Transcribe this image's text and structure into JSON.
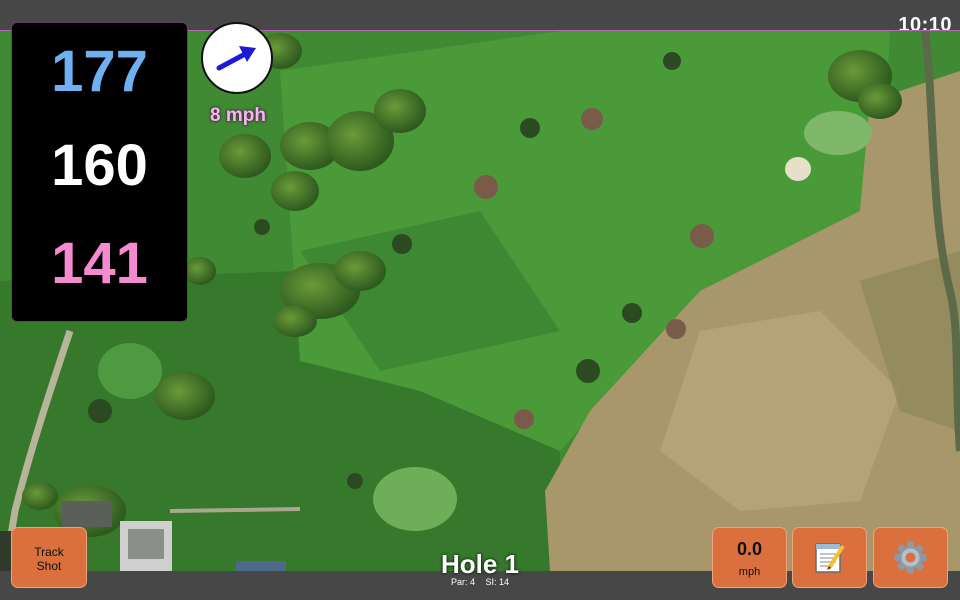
{
  "status_bar": {
    "time": "10:10"
  },
  "distances": {
    "back": "177",
    "middle": "160",
    "front": "141"
  },
  "wind": {
    "speed": "8 mph",
    "icon": "arrow-icon",
    "direction": "north-east"
  },
  "hole": {
    "title": "Hole 1",
    "par": "Par: 4",
    "stroke_index": "SI: 14"
  },
  "buttons": {
    "track_shot_line1": "Track",
    "track_shot_line2": "Shot",
    "speed_value": "0.0",
    "speed_unit": "mph",
    "scorecard_icon": "notepad-icon",
    "settings_icon": "gear-icon"
  },
  "colors": {
    "back_distance": "#6eb0f2",
    "middle_distance": "#ffffff",
    "front_distance": "#f58ad0",
    "button": "#d9703e",
    "wind_arrow": "#1a1ad8"
  }
}
